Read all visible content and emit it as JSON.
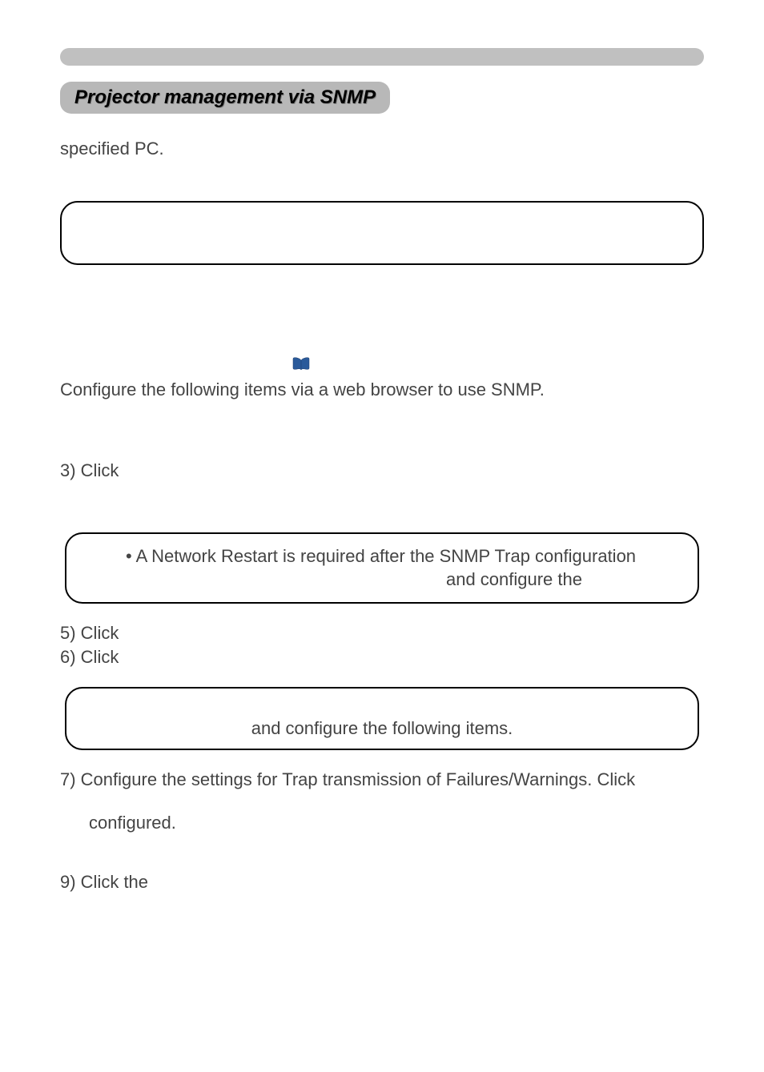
{
  "section_title": "Projector management via SNMP",
  "line1": "specified PC.",
  "config_text": "Configure the following items via a web browser to use SNMP.",
  "step3": "3) Click",
  "note1_line1": "• A Network Restart is required after the SNMP Trap configuration",
  "note1_line2": "and configure the",
  "step5": "5) Click",
  "step6": "6) Click",
  "note2_text": "and configure the following items.",
  "step7": "7) Configure the settings for Trap transmission of Failures/Warnings. Click",
  "step7b": "configured.",
  "step9": "9) Click the"
}
